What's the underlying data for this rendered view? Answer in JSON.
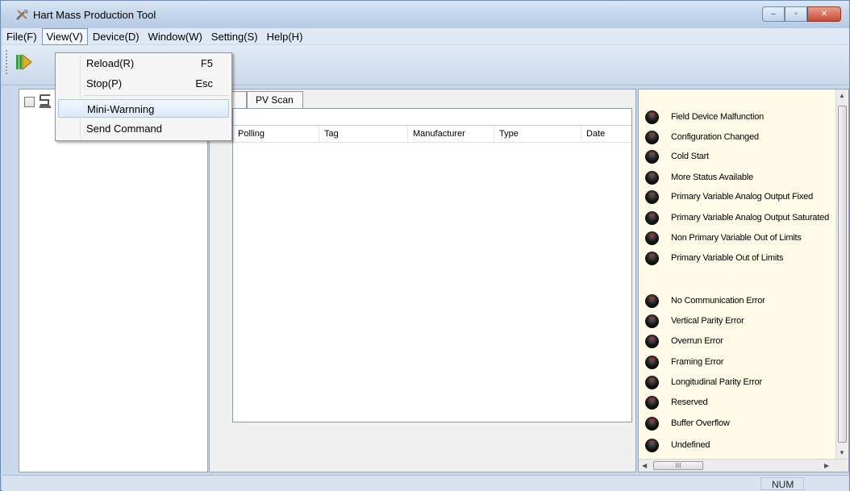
{
  "window": {
    "title": "Hart Mass Production Tool",
    "controls": {
      "minimize": "–",
      "maximize": "▫",
      "close": "✕"
    }
  },
  "menubar": [
    {
      "label": "File(F)"
    },
    {
      "label": "View(V)"
    },
    {
      "label": "Device(D)"
    },
    {
      "label": "Window(W)"
    },
    {
      "label": "Setting(S)"
    },
    {
      "label": "Help(H)"
    }
  ],
  "view_menu": {
    "items": [
      {
        "label": "Reload(R)",
        "shortcut": "F5"
      },
      {
        "label": "Stop(P)",
        "shortcut": "Esc"
      },
      {
        "label": "Mini-Warnning",
        "shortcut": ""
      },
      {
        "label": "Send Command",
        "shortcut": ""
      }
    ]
  },
  "tabs": {
    "partial": "l",
    "pv_scan": "PV Scan"
  },
  "table": {
    "columns": [
      "Polling",
      "Tag",
      "Manufacturer",
      "Type",
      "Date"
    ]
  },
  "status_group_1": [
    "Field Device Malfunction",
    "Configuration Changed",
    "Cold Start",
    "More Status Available",
    "Primary Variable Analog Output Fixed",
    "Primary Variable Analog Output Saturated",
    "Non Primary Variable Out of Limits",
    "Primary Variable Out of Limits"
  ],
  "status_group_2": [
    "No Communication Error",
    "Vertical Parity Error",
    "Overrun Error",
    "Framing Error",
    "Longitudinal Parity Error",
    "Reserved",
    "Buffer Overflow",
    "Undefined"
  ],
  "statusbar": {
    "num": "NUM"
  },
  "scrollbar": {
    "thumb_grip": "III"
  },
  "colors": {
    "title_gradient": "#c4d6ec",
    "status_dot": "#000000",
    "panel_bg": "#fffbe8"
  }
}
